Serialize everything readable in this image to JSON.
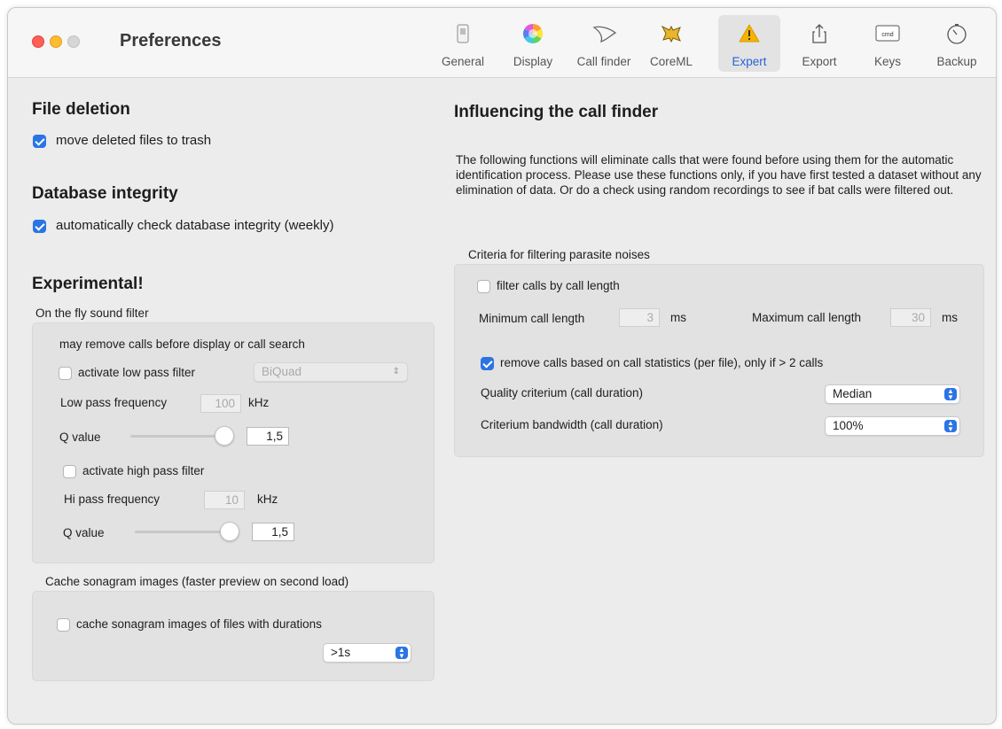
{
  "window": {
    "title": "Preferences"
  },
  "toolbar": [
    {
      "label": "General",
      "icon": "general-switch-icon"
    },
    {
      "label": "Display",
      "icon": "color-wheel-icon"
    },
    {
      "label": "Call finder",
      "icon": "bat-outline-icon"
    },
    {
      "label": "CoreML",
      "icon": "bat-yellow-icon"
    },
    {
      "label": "Expert",
      "icon": "warning-icon"
    },
    {
      "label": "Export",
      "icon": "share-icon"
    },
    {
      "label": "Keys",
      "icon": "cmd-key-icon"
    },
    {
      "label": "Backup",
      "icon": "timer-icon"
    }
  ],
  "active_tab": "Expert",
  "left": {
    "file_deletion": {
      "heading": "File deletion",
      "move_trash_label": "move deleted files to trash",
      "move_trash_checked": true
    },
    "db_integrity": {
      "heading": "Database integrity",
      "check_label": "automatically check database integrity (weekly)",
      "check_checked": true
    },
    "experimental": {
      "heading": "Experimental!",
      "sound_filter_title": "On the fly sound filter",
      "note": "may remove calls before display or call search",
      "lowpass_label": "activate low pass filter",
      "lowpass_checked": false,
      "lowpass_type": "BiQuad",
      "lowpass_freq_label": "Low pass frequency",
      "lowpass_freq_value": "100",
      "khz": "kHz",
      "q_label": "Q value",
      "lowpass_q_value": "1,5",
      "highpass_label": "activate high pass filter",
      "highpass_checked": false,
      "highpass_freq_label": "Hi pass frequency",
      "highpass_freq_value": "10",
      "highpass_q_value": "1,5"
    },
    "cache": {
      "title": "Cache sonagram images (faster preview on second load)",
      "label": "cache sonagram images of files with durations",
      "checked": false,
      "duration_value": ">1s"
    }
  },
  "right": {
    "heading": "Influencing the call finder",
    "description": "The following functions will eliminate calls that were found before using them for the automatic identification process. Please use these functions only, if you have first tested a dataset without any elimination of data. Or do a check using random recordings to see if bat calls were filtered out.",
    "criteria_title": "Criteria for filtering parasite noises",
    "filter_length_label": "filter calls by call length",
    "filter_length_checked": false,
    "min_label": "Minimum call length",
    "min_value": "3",
    "max_label": "Maximum call length",
    "max_value": "30",
    "ms": "ms",
    "stats_label": "remove calls based on call statistics (per file), only if > 2 calls",
    "stats_checked": true,
    "quality_label": "Quality criterium (call duration)",
    "quality_value": "Median",
    "bandwidth_label": "Criterium bandwidth (call duration)",
    "bandwidth_value": "100%"
  },
  "colors": {
    "accent": "#2b74e4",
    "active_tab_text": "#2a63d6",
    "warning": "#f5b301"
  }
}
